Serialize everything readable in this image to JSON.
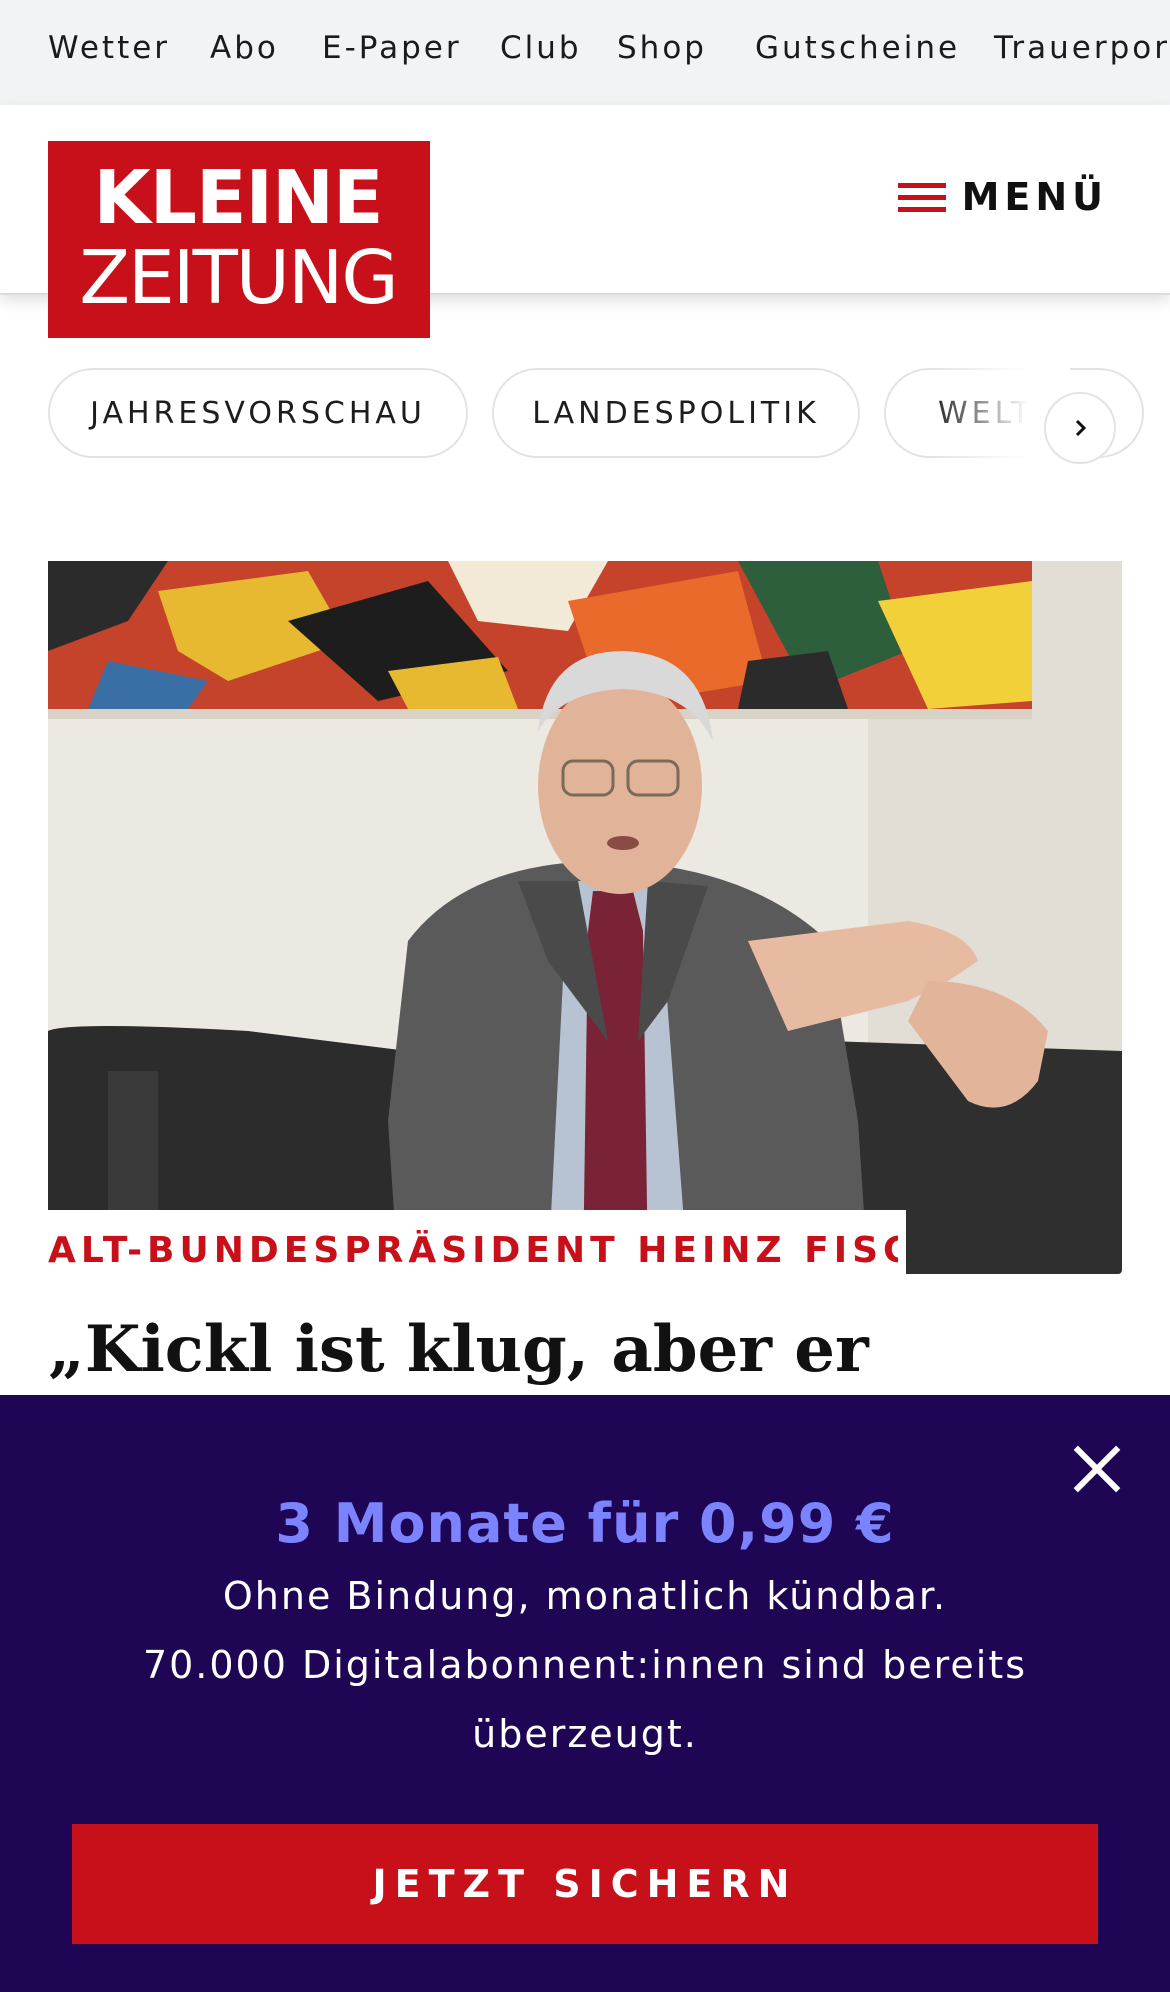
{
  "topnav": {
    "items": [
      "Wetter",
      "Abo",
      "E-Paper",
      "Club",
      "Shop",
      "Gutscheine",
      "Trauerportal"
    ]
  },
  "header": {
    "logo_line1": "KLEINE",
    "logo_line2": "ZEITUNG",
    "menu_label": "MENÜ"
  },
  "topics": {
    "items": [
      "JAHRESVORSCHAU",
      "LANDESPOLITIK",
      "WELT"
    ]
  },
  "article": {
    "kicker": "ALT-BUNDESPRÄSIDENT HEINZ FISC…",
    "headline": "„Kickl ist klug, aber er"
  },
  "banner": {
    "offer_title": "3 Monate für 0,99 €",
    "line1": "Ohne Bindung, monatlich kündbar.",
    "line2": "70.000 Digitalabonnent:innen sind bereits",
    "line3": "überzeugt.",
    "cta_label": "JETZT SICHERN"
  },
  "colors": {
    "brand_red": "#c8101a",
    "banner_bg": "#1f0654",
    "offer_accent": "#7b83ff"
  }
}
